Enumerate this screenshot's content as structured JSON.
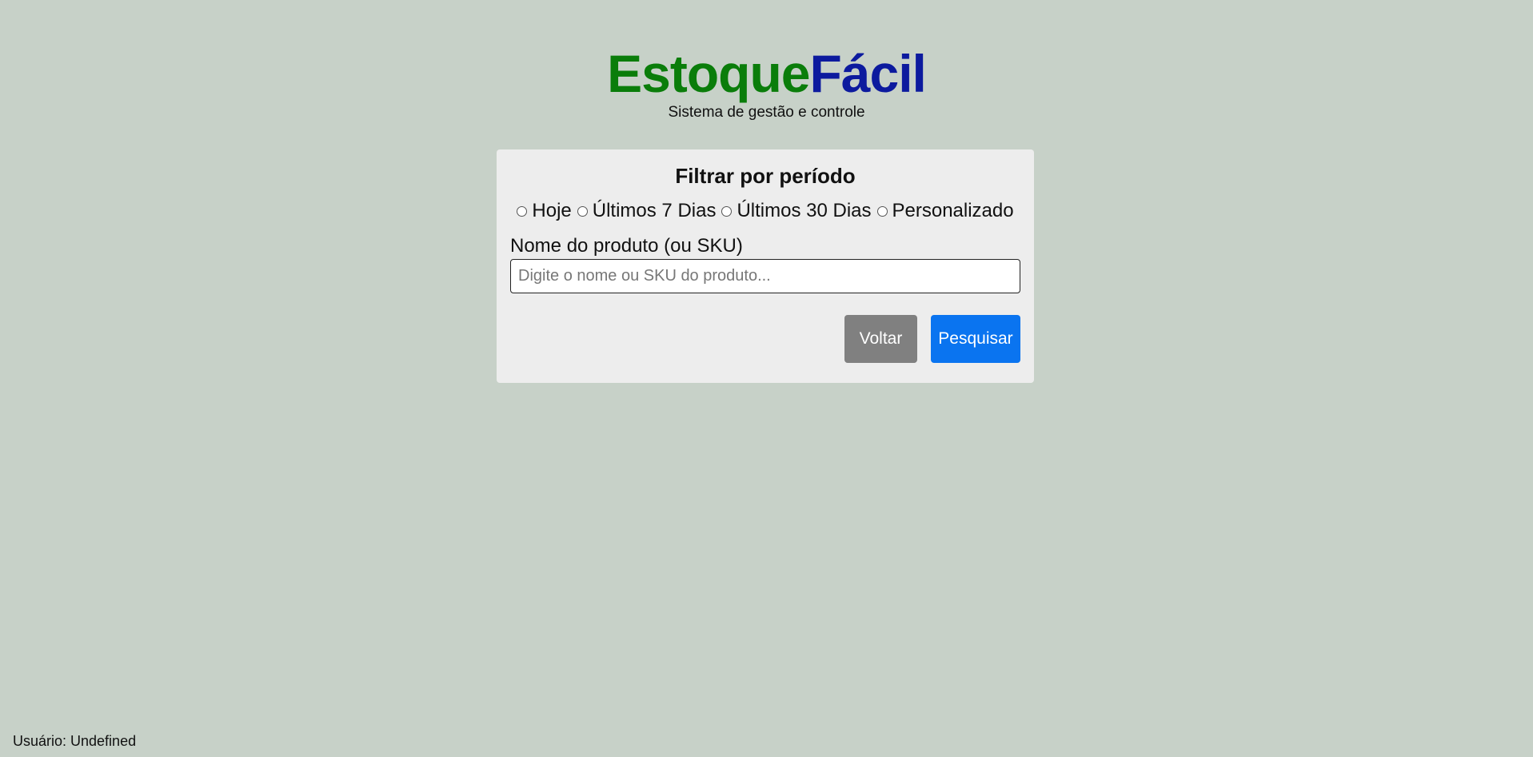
{
  "brand": {
    "part1": "Estoque",
    "part2": "Fácil",
    "subtitle": "Sistema de gestão e controle",
    "colors": {
      "part1": "#0a7d0a",
      "part2": "#0c1a9e"
    }
  },
  "filter": {
    "title": "Filtrar por período",
    "options": [
      {
        "label": "Hoje",
        "selected": false
      },
      {
        "label": "Últimos 7 Dias",
        "selected": false
      },
      {
        "label": "Últimos 30 Dias",
        "selected": false
      },
      {
        "label": "Personalizado",
        "selected": false
      }
    ],
    "product_label": "Nome do produto (ou SKU)",
    "product_placeholder": "Digite o nome ou SKU do produto...",
    "product_value": ""
  },
  "actions": {
    "back_label": "Voltar",
    "search_label": "Pesquisar",
    "colors": {
      "back": "#808080",
      "search": "#0a74f0"
    }
  },
  "footer": {
    "user_text": "Usuário: Undefined"
  }
}
